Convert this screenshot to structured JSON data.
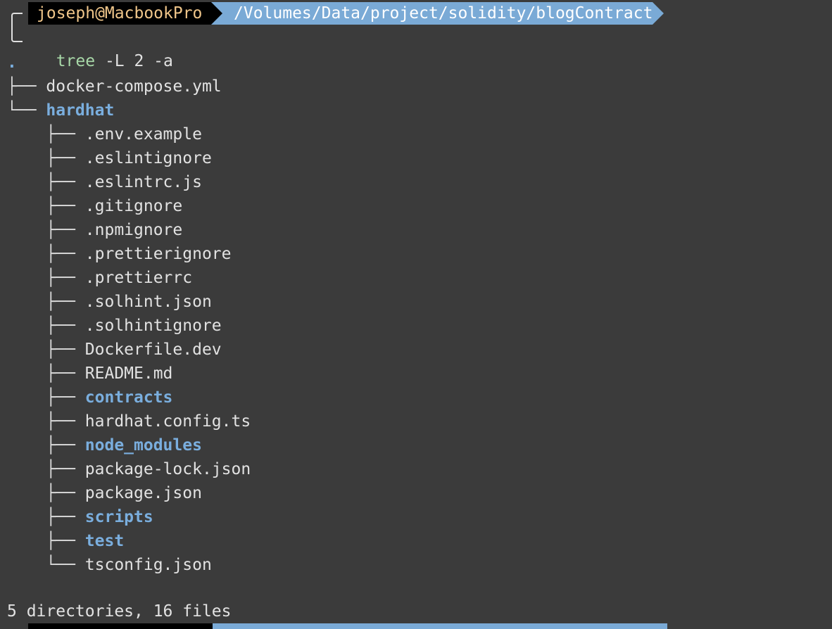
{
  "prompt": {
    "user_host": "joseph@MacbookPro",
    "path": "/Volumes/Data/project/solidity/blogContract",
    "command_name": "tree",
    "command_args": " -L 2 -a"
  },
  "tree": {
    "root": ".",
    "top_level": [
      {
        "name": "docker-compose.yml",
        "type": "file",
        "branch": "├── "
      },
      {
        "name": "hardhat",
        "type": "dir",
        "branch": "└── "
      }
    ],
    "hardhat_children": [
      {
        "name": ".env.example",
        "type": "file",
        "branch": "├── "
      },
      {
        "name": ".eslintignore",
        "type": "file",
        "branch": "├── "
      },
      {
        "name": ".eslintrc.js",
        "type": "file",
        "branch": "├── "
      },
      {
        "name": ".gitignore",
        "type": "file",
        "branch": "├── "
      },
      {
        "name": ".npmignore",
        "type": "file",
        "branch": "├── "
      },
      {
        "name": ".prettierignore",
        "type": "file",
        "branch": "├── "
      },
      {
        "name": ".prettierrc",
        "type": "file",
        "branch": "├── "
      },
      {
        "name": ".solhint.json",
        "type": "file",
        "branch": "├── "
      },
      {
        "name": ".solhintignore",
        "type": "file",
        "branch": "├── "
      },
      {
        "name": "Dockerfile.dev",
        "type": "file",
        "branch": "├── "
      },
      {
        "name": "README.md",
        "type": "file",
        "branch": "├── "
      },
      {
        "name": "contracts",
        "type": "dir",
        "branch": "├── "
      },
      {
        "name": "hardhat.config.ts",
        "type": "file",
        "branch": "├── "
      },
      {
        "name": "node_modules",
        "type": "dir",
        "branch": "├── "
      },
      {
        "name": "package-lock.json",
        "type": "file",
        "branch": "├── "
      },
      {
        "name": "package.json",
        "type": "file",
        "branch": "├── "
      },
      {
        "name": "scripts",
        "type": "dir",
        "branch": "├── "
      },
      {
        "name": "test",
        "type": "dir",
        "branch": "├── "
      },
      {
        "name": "tsconfig.json",
        "type": "file",
        "branch": "└── "
      }
    ],
    "summary": "5 directories, 16 files"
  },
  "colors": {
    "background": "#3b3b3b",
    "directory": "#7aaede",
    "file": "#e2e2e2",
    "user_host": "#f0c68a",
    "path_segment": "#7aaad6",
    "command": "#a8d8a8"
  }
}
